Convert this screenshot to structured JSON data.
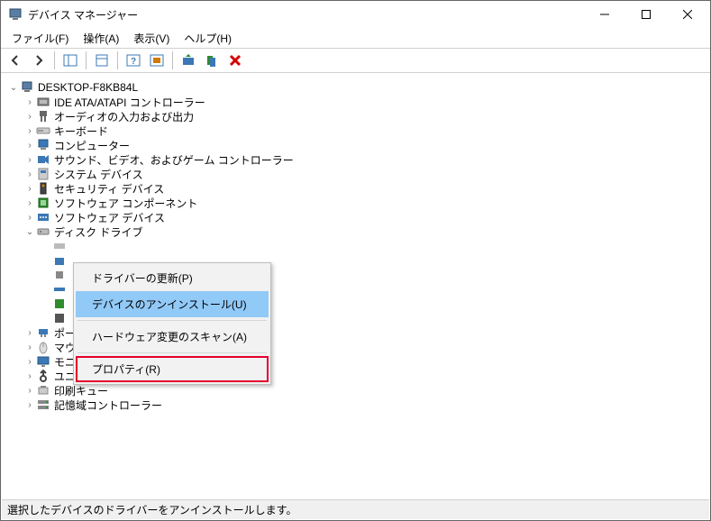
{
  "titlebar": {
    "title": "デバイス マネージャー"
  },
  "menu": {
    "file": "ファイル(F)",
    "action": "操作(A)",
    "view": "表示(V)",
    "help": "ヘルプ(H)"
  },
  "tree": {
    "root": "DESKTOP-F8KB84L",
    "items": [
      "IDE ATA/ATAPI コントローラー",
      "オーディオの入力および出力",
      "キーボード",
      "コンピューター",
      "サウンド、ビデオ、およびゲーム コントローラー",
      "システム デバイス",
      "セキュリティ デバイス",
      "ソフトウェア コンポーネント",
      "ソフトウェア デバイス",
      "ディスク ドライブ",
      "ポート (COM と LPT)",
      "マウスとそのほかのポインティング デバイス",
      "モニター",
      "ユニバーサル シリアル バス コントローラー",
      "印刷キュー",
      "記憶域コントローラー"
    ],
    "expanded_index": 9
  },
  "context_menu": {
    "update_driver": "ドライバーの更新(P)",
    "uninstall": "デバイスのアンインストール(U)",
    "scan_hw": "ハードウェア変更のスキャン(A)",
    "properties": "プロパティ(R)"
  },
  "statusbar": {
    "text": "選択したデバイスのドライバーをアンインストールします。"
  },
  "colors": {
    "highlight": "#91c9f7",
    "toolbar_red": "#d40000",
    "icon_blue": "#3b78b5",
    "icon_green": "#2e8b2e",
    "icon_orange": "#d17a00"
  }
}
